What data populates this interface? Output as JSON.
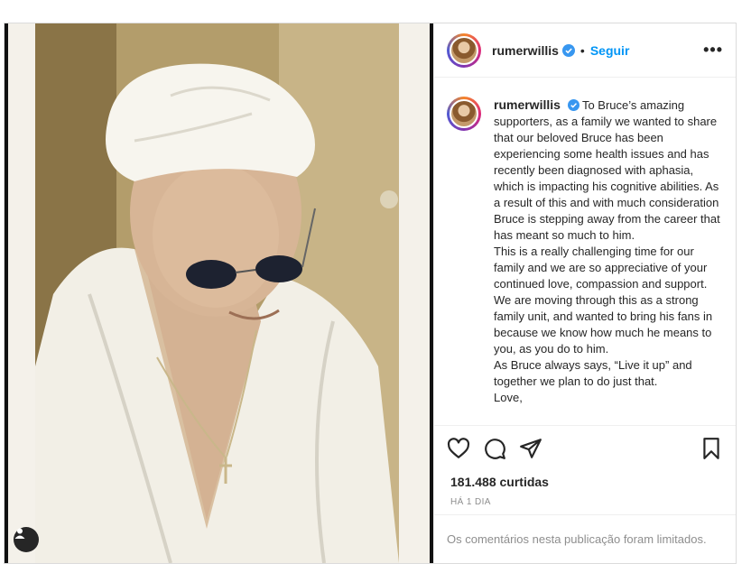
{
  "post": {
    "username": "rumerwillis",
    "follow_label": "Seguir",
    "separator": "•",
    "more_label": "•••",
    "caption_lines": [
      "To Bruce’s amazing supporters, as a family we wanted to share that our beloved Bruce has been experiencing some health issues and has recently been diagnosed with aphasia, which is impacting his cognitive abilities. As a result of this and with much consideration Bruce is stepping away from the career that has meant so much to him.",
      "This is a really challenging time for our family and we are so appreciative of your continued love, compassion and support. We are moving through this as a strong family unit, and wanted to bring his fans in because we know how much he means to you, as you do to him.",
      "As Bruce always says, “Live it up” and together we plan to do just that.",
      "Love,"
    ],
    "likes": "181.488 curtidas",
    "time": "HÁ 1 DIA",
    "comments_note": "Os comentários nesta publicação foram limitados."
  },
  "icons": {
    "like": "heart-icon",
    "comment": "comment-icon",
    "share": "send-icon",
    "save": "bookmark-icon",
    "verified": "verified-badge-icon",
    "user_tags": "user-icon"
  },
  "colors": {
    "accent": "#0095f6",
    "verified": "#3897f0",
    "muted": "#8e8e8e"
  }
}
